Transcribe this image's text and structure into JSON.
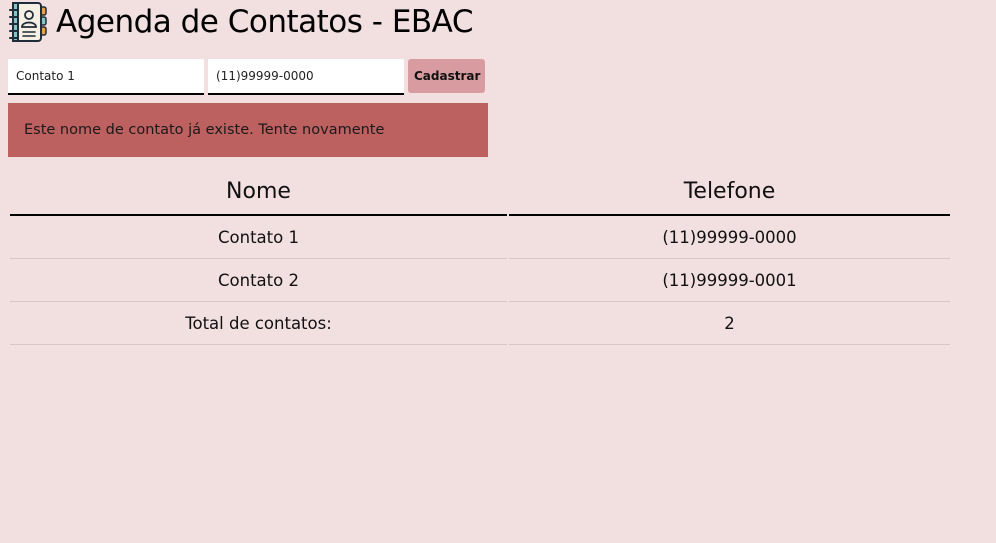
{
  "header": {
    "title": "Agenda de Contatos - EBAC",
    "logo_icon": "address-book-icon"
  },
  "form": {
    "name_value": "Contato 1",
    "phone_value": "(11)99999-0000",
    "submit_label": "Cadastrar"
  },
  "alert": {
    "message": "Este nome de contato já existe. Tente novamente"
  },
  "table": {
    "headers": [
      "Nome",
      "Telefone"
    ],
    "rows": [
      {
        "name": "Contato 1",
        "phone": "(11)99999-0000"
      },
      {
        "name": "Contato 2",
        "phone": "(11)99999-0001"
      }
    ],
    "total_label": "Total de contatos:",
    "total_value": "2"
  },
  "colors": {
    "background": "#f2dfe0",
    "button": "#d89ca0",
    "alert": "#bc6060"
  }
}
